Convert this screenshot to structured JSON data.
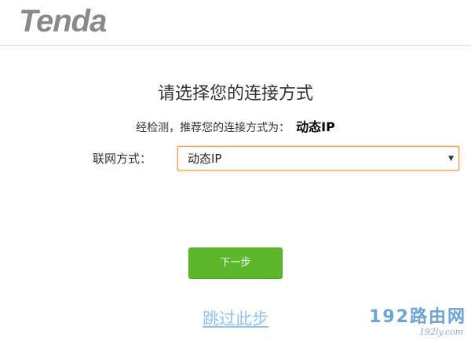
{
  "header": {
    "logo_text": "Tenda"
  },
  "main": {
    "title": "请选择您的连接方式",
    "detect_text": "经检测，推荐您的连接方式为：",
    "detect_result": "动态IP",
    "connection_label": "联网方式：",
    "connection_select": {
      "value": "动态IP",
      "arrow": "▼"
    },
    "next_button": "下一步",
    "skip_link": "跳过此步"
  },
  "watermark": {
    "main": "192路由网",
    "sub": "192ly.com"
  },
  "colors": {
    "primary_button": "#5cb82a",
    "focus_border": "#f39a4a",
    "link": "#8fc3ec",
    "logo": "#8a8a8a"
  }
}
